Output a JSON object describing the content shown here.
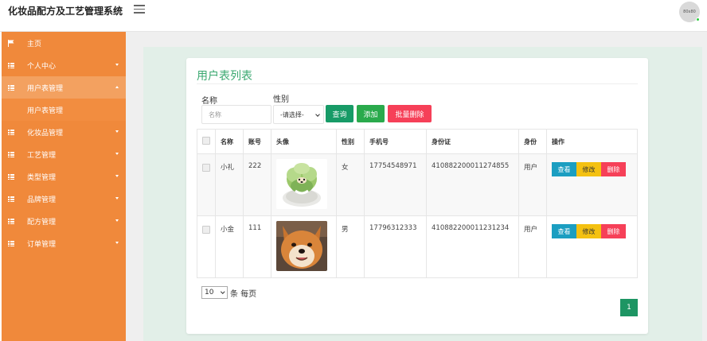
{
  "app": {
    "title": "化妆品配方及工艺管理系统",
    "avatar_text": "80x80"
  },
  "sidebar": {
    "items": [
      {
        "label": "主页",
        "icon": "flag-icon"
      },
      {
        "label": "个人中心",
        "icon": "grid-icon"
      },
      {
        "label": "用户表管理",
        "icon": "grid-icon",
        "expanded": true
      },
      {
        "label": "用户表管理",
        "sub": true
      },
      {
        "label": "化妆品管理",
        "icon": "grid-icon"
      },
      {
        "label": "工艺管理",
        "icon": "grid-icon"
      },
      {
        "label": "类型管理",
        "icon": "grid-icon"
      },
      {
        "label": "品牌管理",
        "icon": "grid-icon"
      },
      {
        "label": "配方管理",
        "icon": "grid-icon"
      },
      {
        "label": "订单管理",
        "icon": "grid-icon"
      }
    ]
  },
  "main": {
    "title": "用户表列表",
    "search": {
      "name_label": "名称",
      "name_placeholder": "名称",
      "gender_label": "性别",
      "gender_value": "-请选择-",
      "query_button": "查询",
      "add_button": "添加",
      "batch_delete_button": "批量删除"
    },
    "table": {
      "columns": [
        "名称",
        "账号",
        "头像",
        "性别",
        "手机号",
        "身份证",
        "身份",
        "操作"
      ],
      "rows": [
        {
          "name": "小礼",
          "account": "222",
          "gender": "女",
          "phone": "17754548971",
          "id_card": "410882200011274855",
          "role": "用户",
          "avatar": "cabbage-dog-avatar"
        },
        {
          "name": "小金",
          "account": "111",
          "gender": "男",
          "phone": "17796312333",
          "id_card": "410882200011231234",
          "role": "用户",
          "avatar": "shiba-dog-avatar"
        }
      ],
      "actions": {
        "view": "查看",
        "edit": "修改",
        "delete": "删除"
      }
    },
    "pagination": {
      "page_size": "10",
      "per_page_label": "条 每页",
      "current_page": "1"
    }
  },
  "colors": {
    "sidebar": "#f0893b",
    "primary_green": "#179b67",
    "title_green": "#3aa870",
    "danger": "#f64058",
    "info": "#1b9ec1",
    "warning": "#f4c111"
  }
}
